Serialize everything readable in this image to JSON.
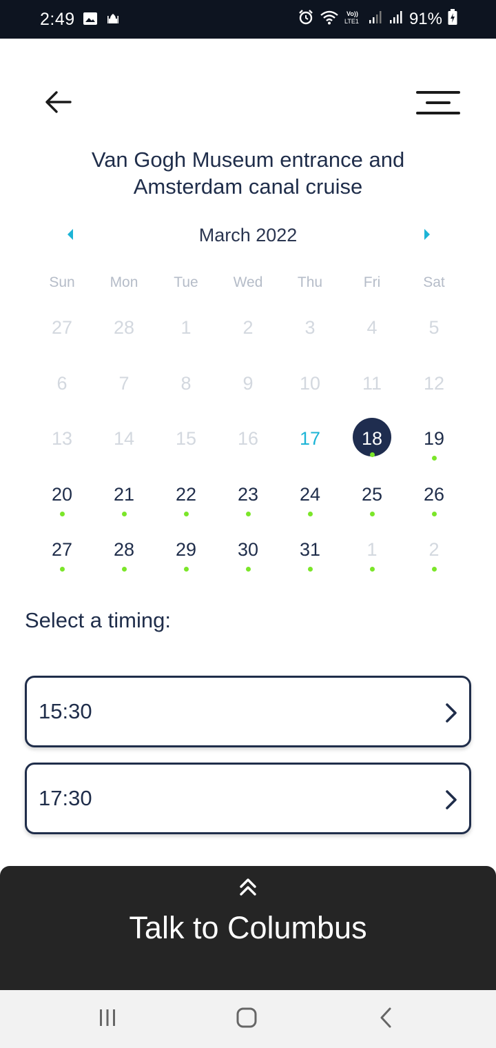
{
  "status_bar": {
    "time": "2:49",
    "battery": "91%",
    "icons": [
      "gallery-icon",
      "mosque-icon",
      "alarm-icon",
      "wifi-icon",
      "volte-icon",
      "signal-icon",
      "signal-icon",
      "battery-charging-icon"
    ]
  },
  "header": {
    "back_icon": "arrow-left-icon",
    "menu_icon": "hamburger-menu-icon",
    "title_line1": "Van Gogh Museum entrance and",
    "title_line2": "Amsterdam canal cruise"
  },
  "calendar": {
    "month_label": "March 2022",
    "prev_icon": "caret-left-icon",
    "next_icon": "caret-right-icon",
    "weekdays": [
      "Sun",
      "Mon",
      "Tue",
      "Wed",
      "Thu",
      "Fri",
      "Sat"
    ],
    "weeks": [
      [
        {
          "d": "27",
          "state": "muted"
        },
        {
          "d": "28",
          "state": "muted"
        },
        {
          "d": "1",
          "state": "muted"
        },
        {
          "d": "2",
          "state": "muted"
        },
        {
          "d": "3",
          "state": "muted"
        },
        {
          "d": "4",
          "state": "muted"
        },
        {
          "d": "5",
          "state": "muted"
        }
      ],
      [
        {
          "d": "6",
          "state": "muted"
        },
        {
          "d": "7",
          "state": "muted"
        },
        {
          "d": "8",
          "state": "muted"
        },
        {
          "d": "9",
          "state": "muted"
        },
        {
          "d": "10",
          "state": "muted"
        },
        {
          "d": "11",
          "state": "muted"
        },
        {
          "d": "12",
          "state": "muted"
        }
      ],
      [
        {
          "d": "13",
          "state": "muted"
        },
        {
          "d": "14",
          "state": "muted"
        },
        {
          "d": "15",
          "state": "muted"
        },
        {
          "d": "16",
          "state": "muted"
        },
        {
          "d": "17",
          "state": "today"
        },
        {
          "d": "18",
          "state": "selected",
          "dot": true
        },
        {
          "d": "19",
          "state": "available",
          "dot": true
        }
      ],
      [
        {
          "d": "20",
          "state": "available",
          "dot": true
        },
        {
          "d": "21",
          "state": "available",
          "dot": true
        },
        {
          "d": "22",
          "state": "available",
          "dot": true
        },
        {
          "d": "23",
          "state": "available",
          "dot": true
        },
        {
          "d": "24",
          "state": "available",
          "dot": true
        },
        {
          "d": "25",
          "state": "available",
          "dot": true
        },
        {
          "d": "26",
          "state": "available",
          "dot": true
        }
      ],
      [
        {
          "d": "27",
          "state": "available",
          "dot": true
        },
        {
          "d": "28",
          "state": "available",
          "dot": true
        },
        {
          "d": "29",
          "state": "available",
          "dot": true
        },
        {
          "d": "30",
          "state": "available",
          "dot": true
        },
        {
          "d": "31",
          "state": "available",
          "dot": true
        },
        {
          "d": "1",
          "state": "muted",
          "dot": true
        },
        {
          "d": "2",
          "state": "muted",
          "dot": true
        }
      ]
    ],
    "colors": {
      "selected_bg": "#1f2d4f",
      "today_text": "#1cb4d6",
      "availability_dot": "#7be629",
      "nav_arrows": "#1cb4d6"
    }
  },
  "timing": {
    "label": "Select a timing:",
    "options": [
      {
        "time": "15:30",
        "icon": "chevron-right-icon"
      },
      {
        "time": "17:30",
        "icon": "chevron-right-icon"
      }
    ]
  },
  "talk_sheet": {
    "label": "Talk to Columbus",
    "icon": "double-chevron-up-icon"
  },
  "nav_bar": {
    "icons": [
      "recent-apps-icon",
      "home-icon",
      "back-nav-icon"
    ]
  }
}
